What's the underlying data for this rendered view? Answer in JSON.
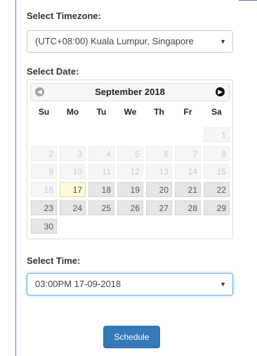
{
  "timezone": {
    "label": "Select Timezone:",
    "value": "(UTC+08:00) Kuala Lumpur, Singapore",
    "caret": "▼"
  },
  "date": {
    "label": "Select Date:",
    "month_title": "September 2018",
    "prev_icon": "◀",
    "next_icon": "▶",
    "weekdays": [
      "Su",
      "Mo",
      "Tu",
      "We",
      "Th",
      "Fr",
      "Sa"
    ],
    "weeks": [
      [
        "",
        "",
        "",
        "",
        "",
        "",
        "1"
      ],
      [
        "2",
        "3",
        "4",
        "5",
        "6",
        "7",
        "8"
      ],
      [
        "9",
        "10",
        "11",
        "12",
        "13",
        "14",
        "15"
      ],
      [
        "16",
        "17",
        "18",
        "19",
        "20",
        "21",
        "22"
      ],
      [
        "23",
        "24",
        "25",
        "26",
        "27",
        "28",
        "29"
      ],
      [
        "30",
        "",
        "",
        "",
        "",
        "",
        ""
      ]
    ],
    "today": "17",
    "first_selectable": "17"
  },
  "time": {
    "label": "Select Time:",
    "value": "03:00PM 17-09-2018",
    "caret": "▼"
  },
  "submit": {
    "label": "Schedule"
  }
}
